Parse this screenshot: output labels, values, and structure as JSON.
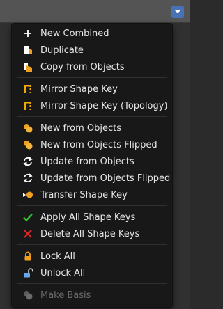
{
  "menu": {
    "items": [
      {
        "label": "New Combined",
        "icon": "plus-icon"
      },
      {
        "label": "Duplicate",
        "icon": "duplicate-icon"
      },
      {
        "label": "Copy from Objects",
        "icon": "copy-from-objects-icon"
      },
      {
        "label": "Mirror Shape Key",
        "icon": "mirror-icon"
      },
      {
        "label": "Mirror Shape Key (Topology)",
        "icon": "mirror-icon"
      },
      {
        "label": "New from Objects",
        "icon": "new-from-objects-icon"
      },
      {
        "label": "New from Objects Flipped",
        "icon": "new-from-objects-icon"
      },
      {
        "label": "Update from Objects",
        "icon": "update-icon"
      },
      {
        "label": "Update from Objects Flipped",
        "icon": "update-icon"
      },
      {
        "label": "Transfer Shape Key",
        "icon": "transfer-icon"
      },
      {
        "label": "Apply All Shape Keys",
        "icon": "checkmark-icon"
      },
      {
        "label": "Delete All Shape Keys",
        "icon": "x-icon"
      },
      {
        "label": "Lock All",
        "icon": "lock-icon"
      },
      {
        "label": "Unlock All",
        "icon": "unlock-icon"
      },
      {
        "label": "Make Basis",
        "icon": "make-basis-icon",
        "disabled": true
      }
    ]
  },
  "colors": {
    "accent_blue": "#4772b3",
    "check_green": "#33cc33",
    "delete_red": "#e02626",
    "mirror_orange": "#f2a900",
    "lock_orange": "#f0a020",
    "unlock_blue": "#6aa7e6"
  }
}
